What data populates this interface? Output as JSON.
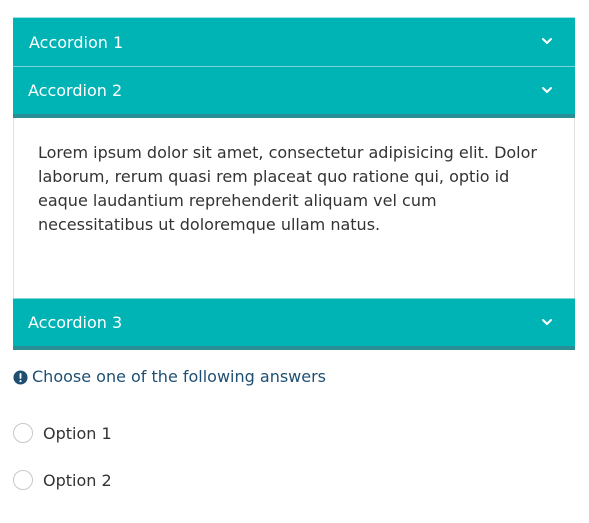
{
  "accordions": [
    {
      "label": "Accordion 1",
      "expanded": false
    },
    {
      "label": "Accordion 2",
      "expanded": true,
      "content": "Lorem ipsum dolor sit amet, consectetur adipisicing elit. Dolor laborum, rerum quasi rem placeat quo ratione qui, optio id eaque laudantium reprehenderit aliquam vel cum necessitatibus ut doloremque ullam natus."
    },
    {
      "label": "Accordion 3",
      "expanded": false
    }
  ],
  "question": {
    "icon": "exclamation-circle-icon",
    "text": "Choose one of the following answers"
  },
  "options": [
    {
      "label": "Option 1",
      "selected": false
    },
    {
      "label": "Option 2",
      "selected": false
    }
  ],
  "colors": {
    "accordion_bg": "#00b4b6",
    "accordion_active_border": "#2b8e96",
    "question_text": "#1e4f73"
  }
}
